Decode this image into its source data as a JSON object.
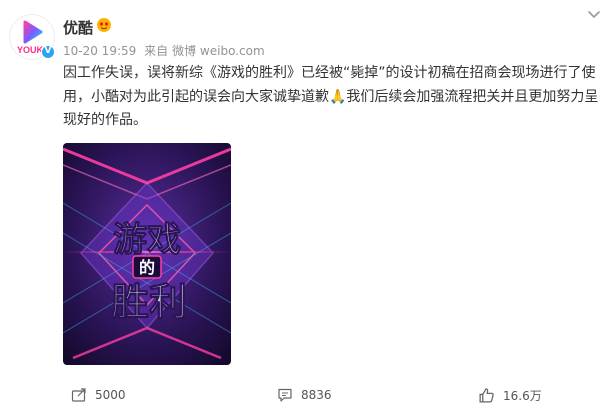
{
  "post": {
    "user": {
      "name": "优酷",
      "avatar_logo_text": "YOUK",
      "verified_mark": "V"
    },
    "meta": {
      "time": "10-20 19:59",
      "source_prefix": "来自",
      "source": "微博 weibo.com"
    },
    "text": "因工作失误，误将新综《游戏的胜利》已经被“毙掉”的设计初稿在招商会现场进行了使用，小酷对为此引起的误会向大家诚挚道歉🙏我们后续会加强流程把关并且更加努力呈现好的作品。",
    "image": {
      "title_line1": "游戏",
      "title_middle": "的",
      "title_line2": "胜利"
    },
    "actions": {
      "share_count": "5000",
      "comment_count": "8836",
      "like_count": "16.6万"
    }
  },
  "colors": {
    "brand_blue": "#2ea4f0",
    "brand_pink": "#ff2b8a",
    "meta_gray": "#939393",
    "poster_purple": "#3b1a6e"
  },
  "icons": {
    "share": "share-icon",
    "comment": "comment-icon",
    "like": "thumbs-up-icon",
    "more": "chevron-down-icon",
    "vip": "vip-face-icon"
  }
}
